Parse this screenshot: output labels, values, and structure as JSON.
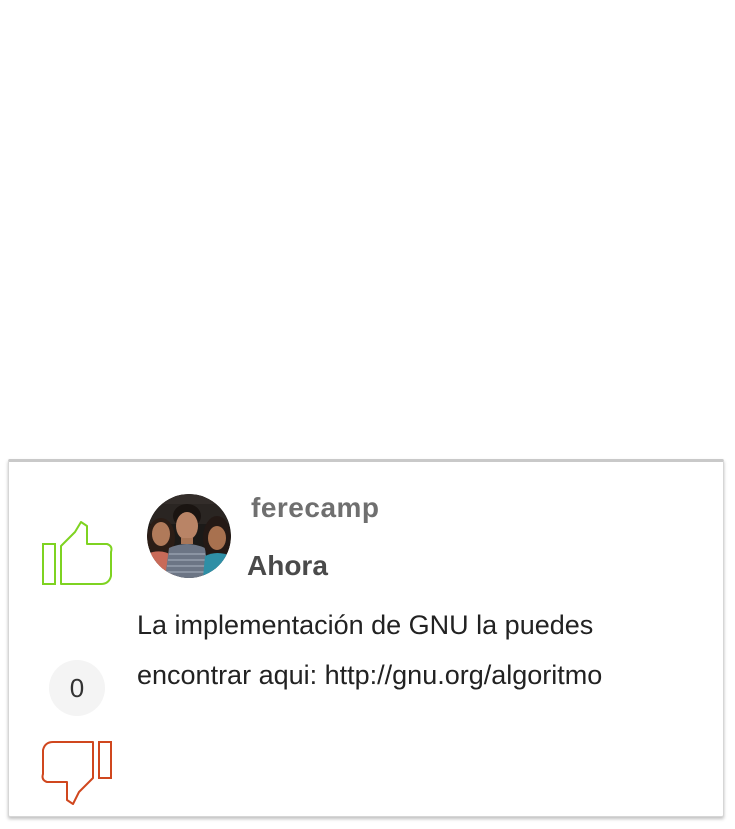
{
  "comment": {
    "author": "ferecamp",
    "time": "Ahora",
    "text": "La implementación de GNU la puedes encontrar aqui: http://gnu.org/algoritmo",
    "votes": "0"
  },
  "icons": {
    "upvote": "thumbs-up-icon",
    "downvote": "thumbs-down-icon",
    "avatar": "user-avatar"
  },
  "colors": {
    "upvote": "#7ed321",
    "downvote": "#d0471e",
    "username": "#6f6f6f",
    "text": "#222222"
  }
}
